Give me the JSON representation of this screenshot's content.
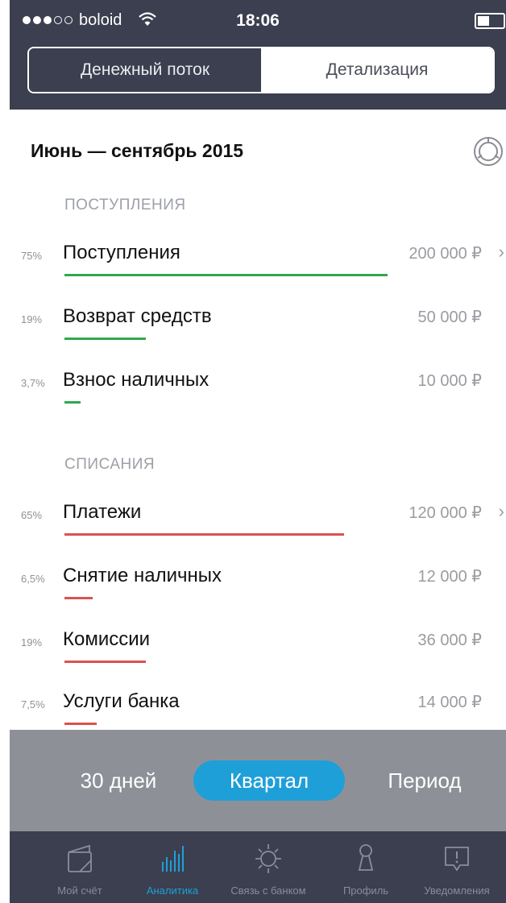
{
  "status": {
    "carrier": "boloid",
    "time": "18:06"
  },
  "segmented": {
    "left": "Денежный поток",
    "right": "Детализация"
  },
  "period_title": "Июнь — сентябрь 2015",
  "income": {
    "header": "ПОСТУПЛЕНИЯ",
    "items": [
      {
        "pct": "75%",
        "label": "Поступления",
        "amount": "200 000 ₽",
        "share": 0.75,
        "has_chevron": true
      },
      {
        "pct": "19%",
        "label": "Возврат средств",
        "amount": "50 000 ₽",
        "share": 0.19
      },
      {
        "pct": "3,7%",
        "label": "Взнос наличных",
        "amount": "10 000 ₽",
        "share": 0.037
      }
    ]
  },
  "expense": {
    "header": "СПИСАНИЯ",
    "items": [
      {
        "pct": "65%",
        "label": "Платежи",
        "amount": "120 000 ₽",
        "share": 0.65,
        "has_chevron": true
      },
      {
        "pct": "6,5%",
        "label": "Снятие наличных",
        "amount": "12 000 ₽",
        "share": 0.065
      },
      {
        "pct": "19%",
        "label": "Комиссии",
        "amount": "36 000 ₽",
        "share": 0.19
      },
      {
        "pct": "7,5%",
        "label": "Услуги банка",
        "amount": "14 000 ₽",
        "share": 0.075
      }
    ]
  },
  "period_selector": {
    "days": "30 дней",
    "quarter": "Квартал",
    "custom": "Период"
  },
  "tabs": [
    {
      "label": "Мой счёт",
      "icon": "wallet-icon"
    },
    {
      "label": "Аналитика",
      "icon": "analytics-icon",
      "active": true
    },
    {
      "label": "Связь с банком",
      "icon": "bank-contact-icon"
    },
    {
      "label": "Профиль",
      "icon": "profile-icon"
    },
    {
      "label": "Уведомления",
      "icon": "notifications-icon"
    }
  ],
  "colors": {
    "header": "#3b3f4f",
    "income_bar": "#2fa84f",
    "expense_bar": "#d9534f",
    "accent": "#1f9fd8"
  }
}
